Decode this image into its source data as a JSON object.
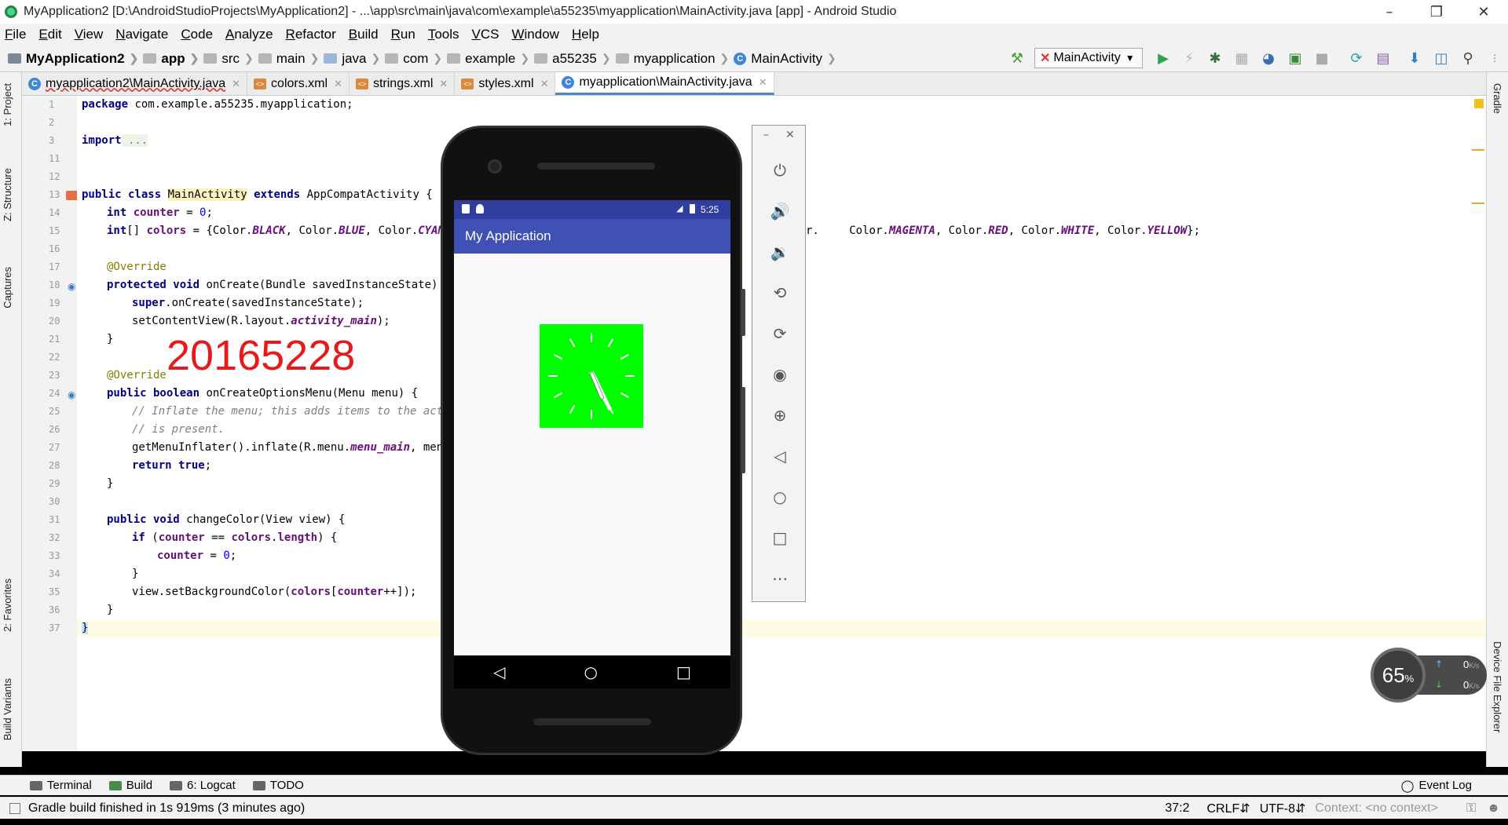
{
  "window": {
    "title": "MyApplication2 [D:\\AndroidStudioProjects\\MyApplication2] - ...\\app\\src\\main\\java\\com\\example\\a55235\\myapplication\\MainActivity.java [app] - Android Studio"
  },
  "menu": [
    "File",
    "Edit",
    "View",
    "Navigate",
    "Code",
    "Analyze",
    "Refactor",
    "Build",
    "Run",
    "Tools",
    "VCS",
    "Window",
    "Help"
  ],
  "breadcrumb": [
    "MyApplication2",
    "app",
    "src",
    "main",
    "java",
    "com",
    "example",
    "a55235",
    "myapplication",
    "MainActivity"
  ],
  "run_config": "MainActivity",
  "tabs": [
    {
      "label": "myapplication2\\MainActivity.java",
      "type": "java"
    },
    {
      "label": "colors.xml",
      "type": "xml"
    },
    {
      "label": "strings.xml",
      "type": "xml"
    },
    {
      "label": "styles.xml",
      "type": "xml"
    },
    {
      "label": "myapplication\\MainActivity.java",
      "type": "java",
      "active": true
    }
  ],
  "left_tools": [
    "1: Project",
    "Z: Structure",
    "Captures",
    "2: Favorites",
    "Build Variants"
  ],
  "right_tools": [
    "Gradle",
    "Device File Explorer"
  ],
  "line_numbers": [
    "1",
    "2",
    "3",
    "11",
    "12",
    "13",
    "14",
    "15",
    "16",
    "17",
    "18",
    "19",
    "20",
    "21",
    "22",
    "23",
    "24",
    "25",
    "26",
    "27",
    "28",
    "29",
    "30",
    "31",
    "32",
    "33",
    "34",
    "35",
    "36",
    "37"
  ],
  "code": {
    "l1_kw": "package",
    "l1_rest": " com.example.a55235.myapplication;",
    "l3_kw": "import",
    "l3_rest": " ...",
    "l13_a": "public class ",
    "l13_b": "MainActivity",
    "l13_c": " extends ",
    "l13_d": "AppCompatActivity {",
    "l14_kw": "int ",
    "l14_fld": "counter",
    "l14_eq": " = ",
    "l14_num": "0",
    "l14_end": ";",
    "l15_a": "int",
    "l15_b": "[] ",
    "l15_fld": "colors",
    "l15_c": " = {Color.",
    "l15_v1": "BLACK",
    "l15_d": ", Color.",
    "l15_v2": "BLUE",
    "l15_e": ", Color.",
    "l15_v3": "CYAN",
    "l15_f": "r.",
    "l15_g": " Color.",
    "l15_v4": "MAGENTA",
    "l15_h": ", Color.",
    "l15_v5": "RED",
    "l15_i": ", Color.",
    "l15_v6": "WHITE",
    "l15_j": ", Color.",
    "l15_v7": "YELLOW",
    "l15_k": "};",
    "l17": "@Override",
    "l18_kw": "protected void ",
    "l18_rest": "onCreate(Bundle savedInstanceState)",
    "l19_kw": "super",
    "l19_rest": ".onCreate(savedInstanceState);",
    "l20_a": "setContentView(R.layout.",
    "l20_b": "activity_main",
    "l20_c": ");",
    "l21": "}",
    "l23": "@Override",
    "l24_kw": "public boolean ",
    "l24_rest": "onCreateOptionsMenu(Menu menu) {",
    "l25": "// Inflate the menu; this adds items to the actio",
    "l26": "// is present.",
    "l27_a": "getMenuInflater().inflate(R.menu.",
    "l27_b": "menu_main",
    "l27_c": ", menu",
    "l28_kw": "return true",
    "l28_end": ";",
    "l29": "}",
    "l31_kw": "public void ",
    "l31_rest": "changeColor(View view) {",
    "l32_kw": "if ",
    "l32_a": "(",
    "l32_fld": "counter",
    "l32_b": " == ",
    "l32_fld2": "colors",
    "l32_c": ".",
    "l32_fld3": "length",
    "l32_d": ") {",
    "l33_fld": "counter",
    "l33_a": " = ",
    "l33_num": "0",
    "l33_b": ";",
    "l34": "}",
    "l35_a": "view.setBackgroundColor(",
    "l35_fld": "colors",
    "l35_b": "[",
    "l35_fld2": "counter",
    "l35_c": "++]);",
    "l36": "}",
    "l37": "}"
  },
  "watermark": "20165228",
  "phone": {
    "status_time": "5:25",
    "app_title": "My Application"
  },
  "netwidget": {
    "percent": "65",
    "percent_sign": "%",
    "up": "0",
    "down": "0",
    "unit": "K/s"
  },
  "bottom_tools": [
    "Terminal",
    "Build",
    "6: Logcat",
    "TODO"
  ],
  "event_log": "Event Log",
  "status": {
    "message": "Gradle build finished in 1s 919ms (3 minutes ago)",
    "position": "37:2",
    "line_sep": "CRLF",
    "encoding": "UTF-8",
    "context": "Context: <no context>"
  },
  "colors": {
    "accent": "#3f51b5",
    "status": "#303f9f",
    "clock_bg": "#00ff00",
    "watermark": "#e8191b"
  }
}
